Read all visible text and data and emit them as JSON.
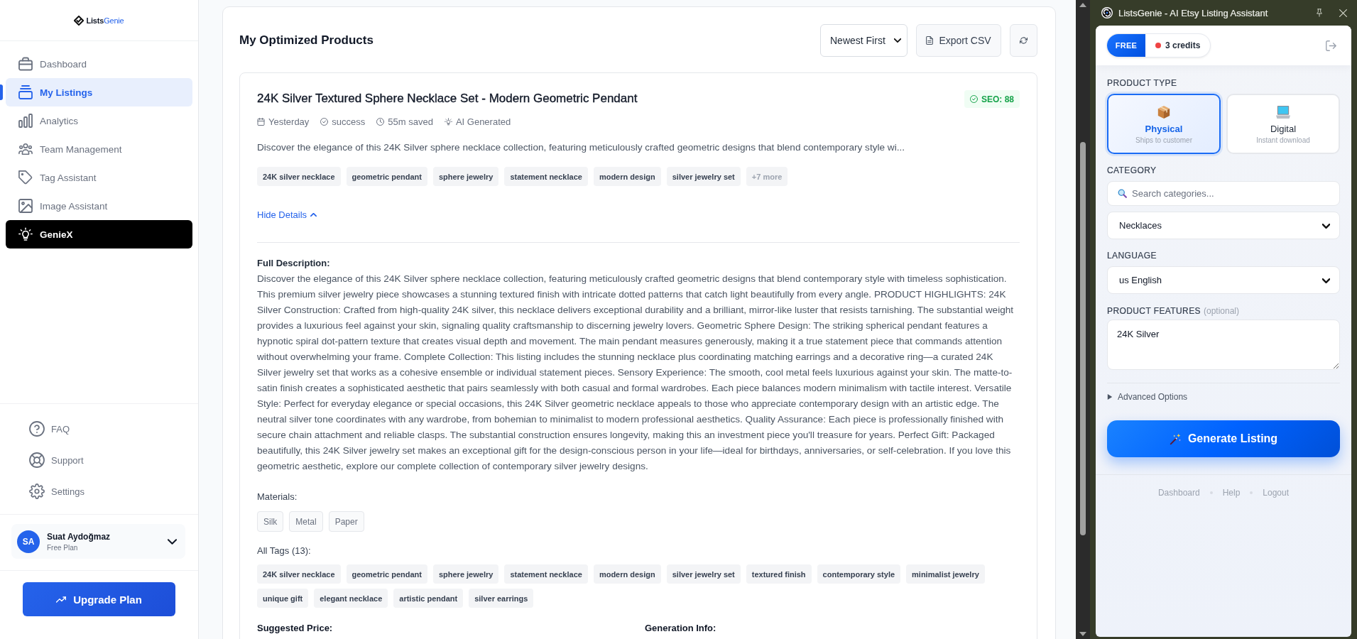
{
  "sidebar": {
    "logo": [
      "Lists",
      "Genie"
    ],
    "nav_items": [
      {
        "label": "Dashboard",
        "kind": "standard",
        "selected": false
      },
      {
        "label": "My Listings",
        "kind": "standard",
        "selected": true
      },
      {
        "label": "Analytics",
        "kind": "standard",
        "selected": false
      },
      {
        "label": "Team Management",
        "kind": "standard",
        "selected": false
      },
      {
        "label": "Tag Assistant",
        "kind": "standard",
        "selected": false
      },
      {
        "label": "Image Assistant",
        "kind": "standard",
        "selected": false
      },
      {
        "label": "GenieX",
        "kind": "featured",
        "selected": false
      }
    ],
    "footer_items": [
      "FAQ",
      "Support",
      "Settings"
    ],
    "user": {
      "initials": "SA",
      "name": "Suat Aydoğmaz",
      "plan": "Free Plan",
      "expanded": false
    },
    "upgrade_button": "Upgrade Plan"
  },
  "products_panel": {
    "title": "My Optimized Products",
    "sort_select": {
      "value": "Newest First"
    },
    "export_button": "Export CSV",
    "product": {
      "title": "24K Silver Textured Sphere Necklace Set - Modern Geometric Pendant",
      "seo_badge": "SEO: 88",
      "meta": [
        "Yesterday",
        "success",
        "55m saved",
        "AI Generated"
      ],
      "excerpt": "Discover the elegance of this 24K Silver sphere necklace collection, featuring meticulously crafted geometric designs that blend contemporary style wi...",
      "tags": [
        "24K silver necklace",
        "geometric pendant",
        "sphere jewelry",
        "statement necklace",
        "modern design",
        "silver jewelry set"
      ],
      "more_tags": "+7 more",
      "details_toggle": {
        "label": "Hide Details",
        "expanded": true
      },
      "details": {
        "description_label": "Full Description:",
        "description": "Discover the elegance of this 24K Silver sphere necklace collection, featuring meticulously crafted geometric designs that blend contemporary style with timeless sophistication. This premium silver jewelry piece showcases a stunning textured finish with intricate dotted patterns that catch light beautifully from every angle. PRODUCT HIGHLIGHTS: 24K Silver Construction: Crafted from high-quality 24K silver, this necklace delivers exceptional durability and a brilliant, mirror-like luster that resists tarnishing. The substantial weight provides a luxurious feel against your skin, signaling quality craftsmanship to discerning jewelry lovers. Geometric Sphere Design: The striking spherical pendant features a hypnotic spiral dot-pattern texture that creates visual depth and movement. The main pendant measures generously, making it a true statement piece that commands attention without overwhelming your frame. Complete Collection: This listing includes the stunning necklace plus coordinating matching earrings and a decorative ring—a curated 24K Silver jewelry set that works as a cohesive ensemble or individual statement pieces. Sensory Experience: The smooth, cool metal feels luxurious against your skin. The matte-to-satin finish creates a sophisticated aesthetic that pairs seamlessly with both casual and formal wardrobes. Each piece balances modern minimalism with tactile interest. Versatile Style: Perfect for everyday elegance or special occasions, this 24K Silver geometric necklace appeals to those who appreciate contemporary design with an artistic edge. The neutral silver tone coordinates with any wardrobe, from bohemian to minimalist to modern professional aesthetics. Quality Assurance: Each piece is professionally finished with secure chain attachment and reliable clasps. The substantial construction ensures longevity, making this an investment piece you'll treasure for years. Perfect Gift: Packaged beautifully, this 24K Silver jewelry set makes an exceptional gift for the design-conscious person in your life—ideal for birthdays, anniversaries, or self-celebration. If you love this geometric aesthetic, explore our complete collection of contemporary silver jewelry designs.",
        "materials_label": "Materials:",
        "materials": [
          "Silk",
          "Metal",
          "Paper"
        ],
        "tags_label": "All Tags (13):",
        "tags": [
          "24K silver necklace",
          "geometric pendant",
          "sphere jewelry",
          "statement necklace",
          "modern design",
          "silver jewelry set",
          "textured finish",
          "contemporary style",
          "minimalist jewelry",
          "unique gift",
          "elegant necklace",
          "artistic pendant",
          "silver earrings"
        ],
        "price_label": "Suggested Price:",
        "generation_label": "Generation Info:"
      }
    }
  },
  "extension": {
    "title": "ListsGenie - AI Etsy Listing Assistant",
    "plan_badge": "FREE",
    "credits": "3 credits",
    "product_type_label": "PRODUCT TYPE",
    "product_types": [
      {
        "label": "Physical",
        "description": "Ships to customer",
        "selected": true
      },
      {
        "label": "Digital",
        "description": "Instant download",
        "selected": false
      }
    ],
    "category_label": "CATEGORY",
    "category_search": {
      "placeholder": "Search categories..."
    },
    "category_select": {
      "value": "Necklaces"
    },
    "language_label": "LANGUAGE",
    "language_select": {
      "value": "us English"
    },
    "features_label": "PRODUCT FEATURES",
    "features_hint": "(optional)",
    "features_field": {
      "value": "24K Silver"
    },
    "advanced_options": {
      "label": "Advanced Options",
      "expanded": false
    },
    "generate_button": "Generate Listing",
    "footer_links": [
      "Dashboard",
      "Help",
      "Logout"
    ]
  }
}
